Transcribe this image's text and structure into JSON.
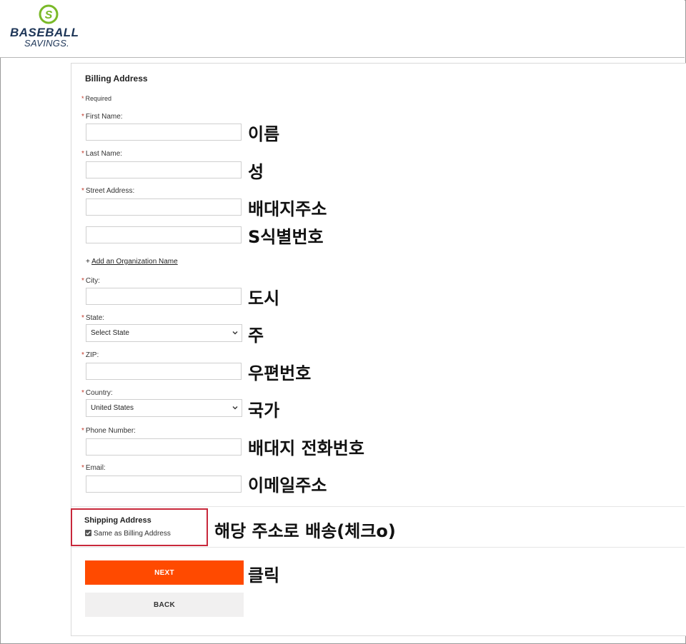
{
  "brand": {
    "name_line1": "BASEBALL",
    "name_line2": "SAVINGS.",
    "mark_color": "#7ab928",
    "text_color": "#1d3557"
  },
  "billing": {
    "title": "Billing Address",
    "required_star": "*",
    "required_note": "Required",
    "first_name_label": "First Name:",
    "last_name_label": "Last Name:",
    "street_label": "Street Address:",
    "add_org_prefix": "+ ",
    "add_org_link": "Add an Organization Name",
    "city_label": "City:",
    "state_label": "State:",
    "state_value": "Select State",
    "zip_label": "ZIP:",
    "country_label": "Country:",
    "country_value": "United States",
    "phone_label": "Phone Number:",
    "email_label": "Email:"
  },
  "shipping": {
    "title": "Shipping Address",
    "same_as_billing_label": "Same as Billing Address",
    "same_as_billing_checked": true
  },
  "buttons": {
    "next_label": "NEXT",
    "back_label": "BACK",
    "next_color": "#ff4a00"
  },
  "annotations": {
    "first_name": "이름",
    "last_name": "성",
    "street": "배대지주소",
    "street2": "S식별번호",
    "city": "도시",
    "state": "주",
    "zip": "우편번호",
    "country": "국가",
    "phone": "배대지 전화번호",
    "email": "이메일주소",
    "shipping": "해당 주소로 배송(체크o)",
    "next": "클릭"
  },
  "highlight_color": "#c8283b"
}
